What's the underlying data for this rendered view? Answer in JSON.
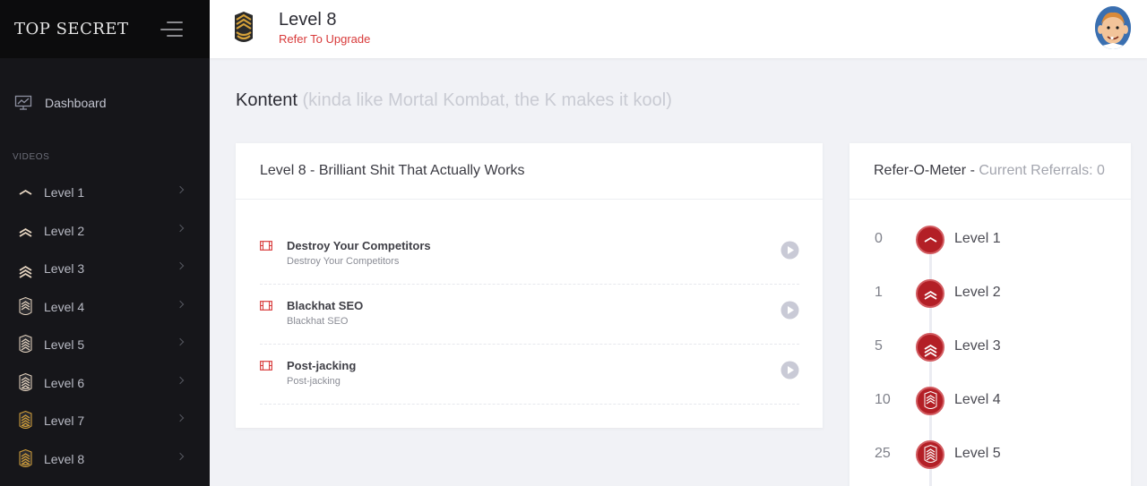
{
  "brand": "TOP SECRET",
  "nav": {
    "dashboard": "Dashboard",
    "section": "VIDEOS",
    "items": [
      {
        "label": "Level 1",
        "rank": 1
      },
      {
        "label": "Level 2",
        "rank": 2
      },
      {
        "label": "Level 3",
        "rank": 3
      },
      {
        "label": "Level 4",
        "rank": 4
      },
      {
        "label": "Level 5",
        "rank": 5
      },
      {
        "label": "Level 6",
        "rank": 6
      },
      {
        "label": "Level 7",
        "rank": 7
      },
      {
        "label": "Level 8",
        "rank": 8
      }
    ]
  },
  "header": {
    "title": "Level 8",
    "subtitle": "Refer To Upgrade"
  },
  "page": {
    "heading": "Kontent",
    "heading_note": "(kinda like Mortal Kombat, the K makes it kool)"
  },
  "content_card": {
    "title": "Level 8 - Brilliant Shit That Actually Works",
    "videos": [
      {
        "title": "Destroy Your Competitors",
        "subtitle": "Destroy Your Competitors"
      },
      {
        "title": "Blackhat SEO",
        "subtitle": "Blackhat SEO"
      },
      {
        "title": "Post-jacking",
        "subtitle": "Post-jacking"
      }
    ]
  },
  "meter": {
    "title": "Refer-O-Meter -",
    "current": "Current Referrals: 0",
    "levels": [
      {
        "count": "0",
        "label": "Level 1",
        "rank": 1
      },
      {
        "count": "1",
        "label": "Level 2",
        "rank": 2
      },
      {
        "count": "5",
        "label": "Level 3",
        "rank": 3
      },
      {
        "count": "10",
        "label": "Level 4",
        "rank": 4
      },
      {
        "count": "25",
        "label": "Level 5",
        "rank": 5
      }
    ]
  },
  "colors": {
    "accent": "#d83a3a",
    "badge": "#b31f26",
    "gold": "#d6a23a",
    "sidebar": "#16161a"
  }
}
